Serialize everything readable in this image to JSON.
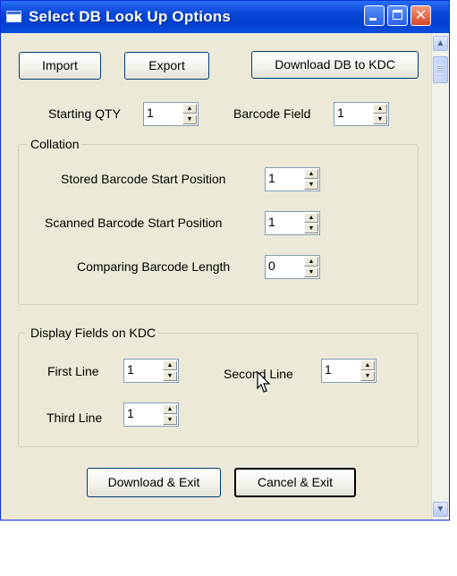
{
  "window": {
    "title": "Select DB Look Up Options"
  },
  "toolbar": {
    "import": "Import",
    "export": "Export",
    "download_db": "Download DB to KDC"
  },
  "starting_qty": {
    "label": "Starting QTY",
    "value": "1"
  },
  "barcode_field": {
    "label": "Barcode Field",
    "value": "1"
  },
  "collation": {
    "title": "Collation",
    "stored_start": {
      "label": "Stored Barcode Start Position",
      "value": "1"
    },
    "scanned_start": {
      "label": "Scanned Barcode Start Position",
      "value": "1"
    },
    "comparing_length": {
      "label": "Comparing Barcode Length",
      "value": "0"
    }
  },
  "display": {
    "title": "Display Fields on KDC",
    "first": {
      "label": "First Line",
      "value": "1"
    },
    "second": {
      "label": "Second Line",
      "value": "1"
    },
    "third": {
      "label": "Third Line",
      "value": "1"
    }
  },
  "footer": {
    "download_exit": "Download & Exit",
    "cancel_exit": "Cancel & Exit"
  },
  "colors": {
    "titlebar": "#0a46d8",
    "dialog_bg": "#ece9d8",
    "button_border": "#003c74"
  },
  "icons": [
    "app-icon",
    "minimize-icon",
    "maximize-icon",
    "close-icon",
    "scroll-up-icon",
    "scroll-down-icon",
    "mouse-cursor-icon"
  ]
}
